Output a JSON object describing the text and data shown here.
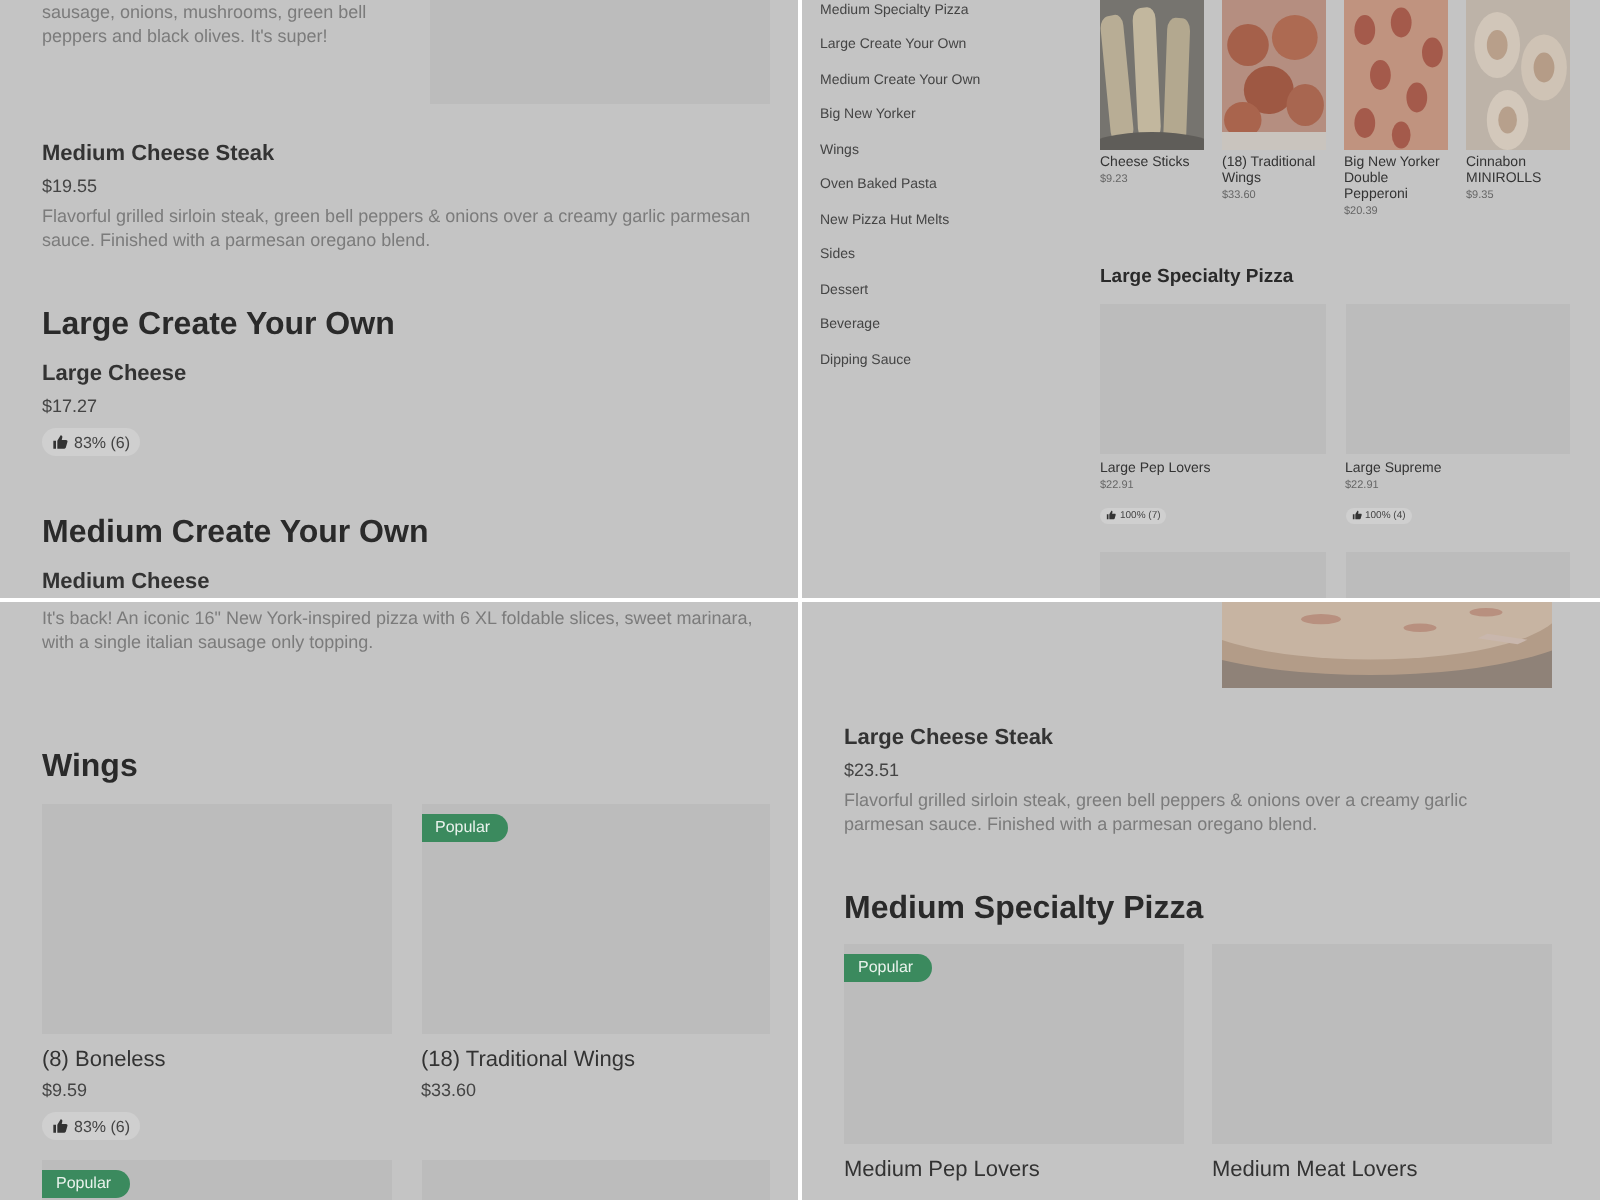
{
  "panels": [
    {
      "blocks": [
        {
          "kind": "item",
          "description": "sausage, onions, mushrooms, green bell peppers and black olives. It's super!",
          "image": {
            "kind": "placeholder"
          }
        },
        {
          "kind": "item",
          "title": "Medium Cheese Steak",
          "price": "$19.55",
          "description": "Flavorful grilled sirloin steak, green bell peppers & onions over a creamy garlic parmesan sauce. Finished with a parmesan oregano blend."
        },
        {
          "kind": "section",
          "title": "Large Create Your Own"
        },
        {
          "kind": "item",
          "title": "Large Cheese",
          "price": "$17.27",
          "rating": "83% (6)"
        },
        {
          "kind": "section",
          "title": "Medium Create Your Own"
        },
        {
          "kind": "item",
          "title": "Medium Cheese"
        }
      ]
    },
    {
      "sidebar": {
        "items": [
          {
            "label": "Medium Specialty Pizza"
          },
          {
            "label": "Large Create Your Own"
          },
          {
            "label": "Medium Create Your Own"
          },
          {
            "label": "Big New Yorker"
          },
          {
            "label": "Wings"
          },
          {
            "label": "Oven Baked Pasta"
          },
          {
            "label": "New Pizza Hut Melts"
          },
          {
            "label": "Sides"
          },
          {
            "label": "Dessert"
          },
          {
            "label": "Beverage"
          },
          {
            "label": "Dipping Sauce"
          }
        ]
      },
      "blocks": [
        {
          "kind": "featured_row",
          "cards": [
            {
              "name": "Cheese Sticks",
              "price": "$9.23"
            },
            {
              "name": "(18) Traditional Wings",
              "price": "$33.60"
            },
            {
              "name": "Big New Yorker Double Pepperoni",
              "price": "$20.39"
            },
            {
              "name": "Cinnabon MINIROLLS",
              "price": "$9.35"
            }
          ]
        },
        {
          "kind": "section",
          "title": "Large Specialty Pizza"
        },
        {
          "kind": "card_grid",
          "cards": [
            {
              "name": "Large Pep Lovers",
              "price": "$22.91",
              "rating": "100% (7)",
              "image": {
                "kind": "placeholder"
              }
            },
            {
              "name": "Large Supreme",
              "price": "$22.91",
              "rating": "100% (4)",
              "image": {
                "kind": "placeholder"
              }
            },
            {
              "image": {
                "kind": "placeholder"
              }
            },
            {
              "image": {
                "kind": "placeholder"
              }
            }
          ]
        }
      ]
    },
    {
      "blocks": [
        {
          "kind": "item",
          "description": "It's back! An iconic 16\" New York-inspired pizza with 6 XL foldable slices, sweet marinara, with a single italian sausage only topping."
        },
        {
          "kind": "section",
          "title": "Wings"
        },
        {
          "kind": "card_grid",
          "cards": [
            {
              "name": "(8) Boneless",
              "price": "$9.59",
              "rating": "83% (6)",
              "image": {
                "kind": "placeholder"
              }
            },
            {
              "name": "(18) Traditional Wings",
              "price": "$33.60",
              "badge": "Popular",
              "image": {
                "kind": "placeholder"
              }
            },
            {
              "badge": "Popular",
              "image": {
                "kind": "placeholder"
              }
            },
            {
              "image": {
                "kind": "placeholder"
              }
            }
          ]
        }
      ]
    },
    {
      "blocks": [
        {
          "kind": "item"
        },
        {
          "kind": "item",
          "title": "Large Cheese Steak",
          "price": "$23.51",
          "description": "Flavorful grilled sirloin steak, green bell peppers & onions over a creamy garlic parmesan sauce. Finished with a parmesan oregano blend."
        },
        {
          "kind": "section",
          "title": "Medium Specialty Pizza"
        },
        {
          "kind": "card_grid",
          "cards": [
            {
              "name": "Medium Pep Lovers",
              "badge": "Popular",
              "image": {
                "kind": "placeholder"
              }
            },
            {
              "name": "Medium Meat Lovers",
              "image": {
                "kind": "placeholder"
              }
            }
          ]
        }
      ]
    }
  ]
}
